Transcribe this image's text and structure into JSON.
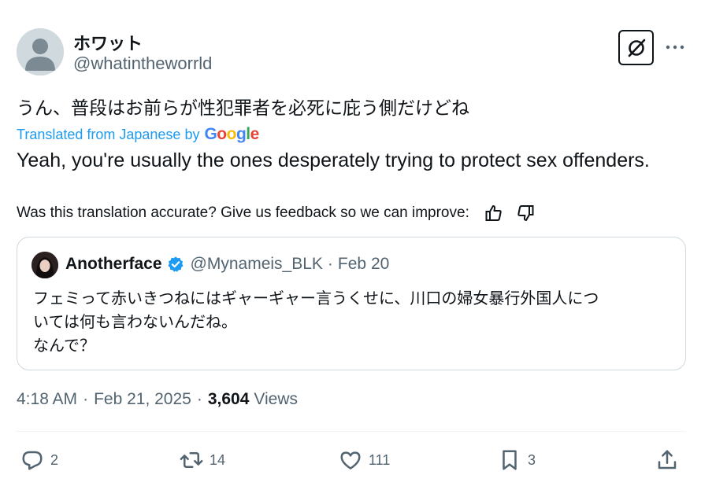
{
  "author": {
    "display_name": "ホワット",
    "handle": "@whatintheworrld",
    "avatar_icon": "default-avatar-icon"
  },
  "header_actions": {
    "grok_icon": "grok-icon",
    "more_icon": "more-horizontal-icon"
  },
  "tweet": {
    "original_text": "うん、普段はお前らが性犯罪者を必死に庇う側だけどね",
    "translated_from_label": "Translated from Japanese by",
    "translator_name": "Google",
    "translation_text": "Yeah, you're usually the ones desperately trying to protect sex offenders.",
    "feedback_prompt": "Was this translation accurate? Give us feedback so we can improve:",
    "feedback_icons": [
      "thumbs-up-icon",
      "thumbs-down-icon"
    ]
  },
  "quote": {
    "display_name": "Anotherface",
    "verified_icon": "verified-badge-icon",
    "handle": "@Mynameis_BLK",
    "separator": "·",
    "date": "Feb 20",
    "text": "フェミって赤いきつねにはギャーギャー言うくせに、川口の婦女暴行外国人につ\nいては何も言わないんだね。\nなんで？"
  },
  "meta": {
    "time": "4:18 AM",
    "separator": "·",
    "date": "Feb 21, 2025",
    "views_count": "3,604",
    "views_label": "Views"
  },
  "actions": {
    "reply_count": "2",
    "retweet_count": "14",
    "like_count": "111",
    "bookmark_count": "3",
    "icons": [
      "reply-icon",
      "retweet-icon",
      "like-icon",
      "bookmark-icon",
      "share-icon"
    ]
  },
  "colors": {
    "text_primary": "#0f1419",
    "text_secondary": "#536471",
    "link_blue": "#1d9bf0",
    "border": "#cfd9de",
    "verified_blue": "#1d9bf0"
  }
}
